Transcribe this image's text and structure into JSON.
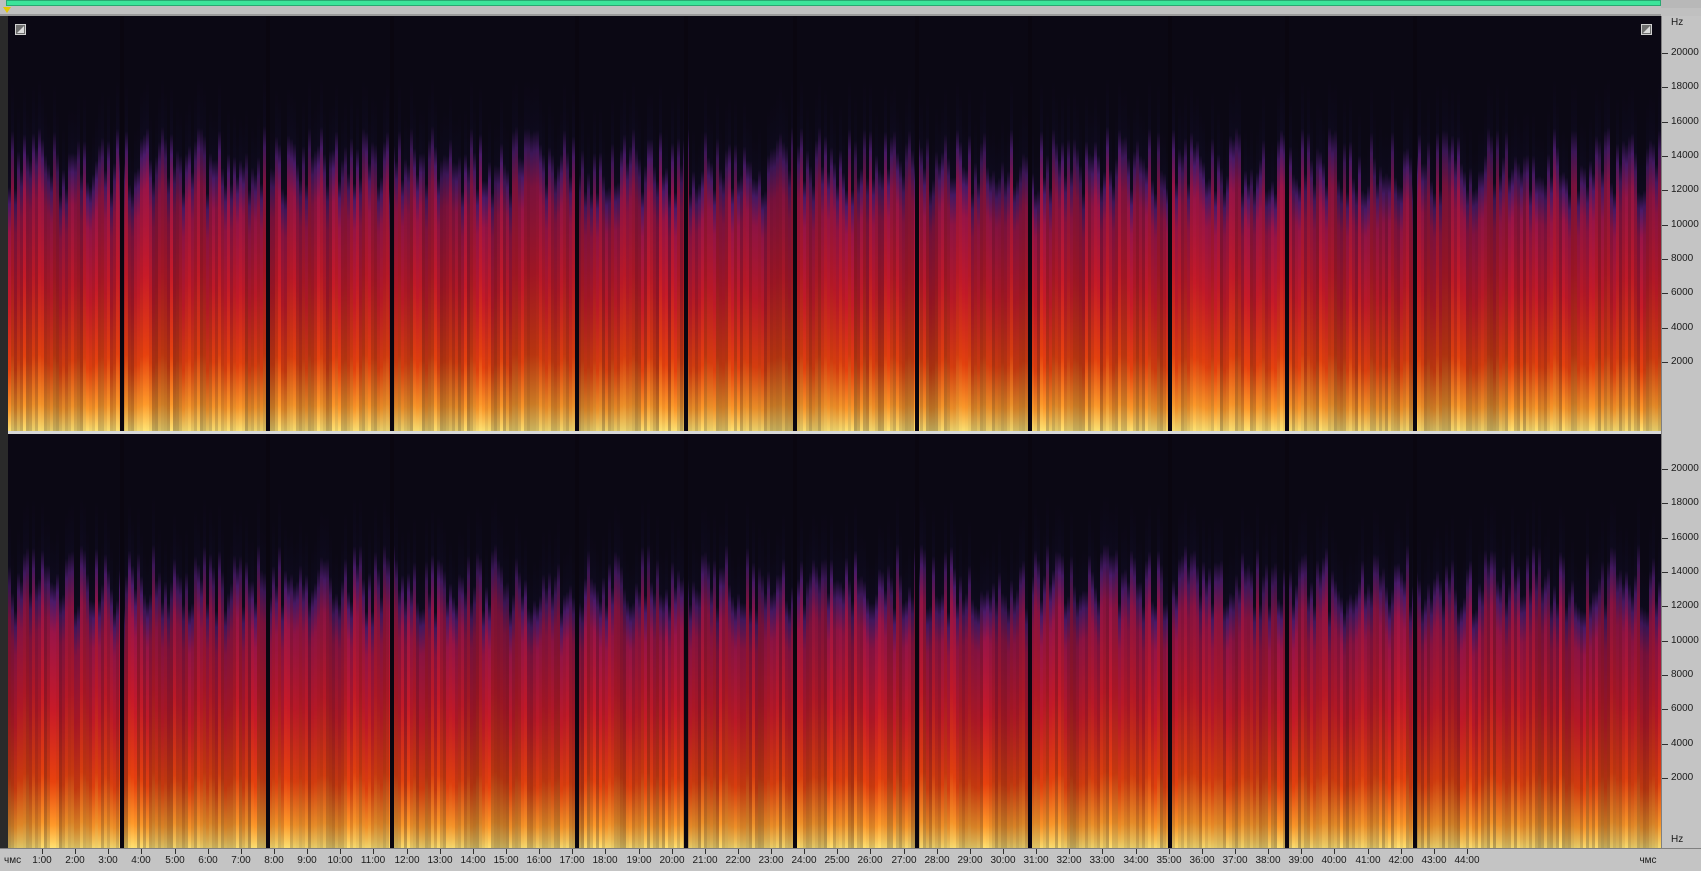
{
  "editor": {
    "freq_unit": "Hz",
    "freq_labels": [
      "20000",
      "18000",
      "16000",
      "14000",
      "12000",
      "10000",
      "8000",
      "6000",
      "4000",
      "2000"
    ],
    "time_start_label": "чмс",
    "time_end_label": "чмс",
    "time_labels": [
      "1:00",
      "2:00",
      "3:00",
      "4:00",
      "5:00",
      "6:00",
      "7:00",
      "8:00",
      "9:00",
      "10:00",
      "11:00",
      "12:00",
      "13:00",
      "14:00",
      "15:00",
      "16:00",
      "17:00",
      "18:00",
      "19:00",
      "20:00",
      "21:00",
      "22:00",
      "23:00",
      "24:00",
      "25:00",
      "26:00",
      "27:00",
      "28:00",
      "29:00",
      "30:00",
      "31:00",
      "32:00",
      "33:00",
      "34:00",
      "35:00",
      "36:00",
      "37:00",
      "38:00",
      "39:00",
      "40:00",
      "41:00",
      "42:00",
      "43:00",
      "44:00"
    ]
  },
  "colors": {
    "overview_bar": "#3ce49a",
    "spectrogram_bg": "#0b0814",
    "low": "#3a1a5a",
    "mid": "#c01030",
    "high": "#ff6a10",
    "peak": "#ffe070"
  }
}
